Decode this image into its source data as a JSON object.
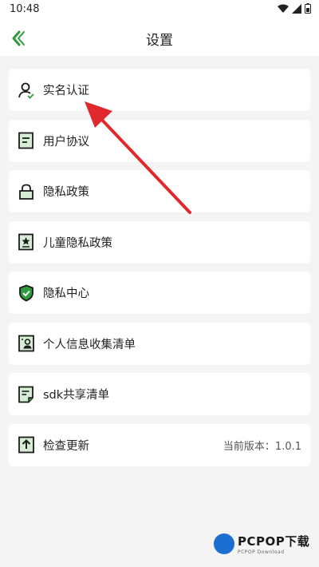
{
  "status": {
    "time": "10:48"
  },
  "header": {
    "title": "设置"
  },
  "items": [
    {
      "label": "实名认证",
      "icon": "user-verify-icon"
    },
    {
      "label": "用户协议",
      "icon": "document-icon"
    },
    {
      "label": "隐私政策",
      "icon": "lock-icon"
    },
    {
      "label": "儿童隐私政策",
      "icon": "star-document-icon"
    },
    {
      "label": "隐私中心",
      "icon": "shield-check-icon"
    },
    {
      "label": "个人信息收集清单",
      "icon": "id-card-icon"
    },
    {
      "label": "sdk共享清单",
      "icon": "list-document-icon"
    },
    {
      "label": "检查更新",
      "icon": "upload-icon",
      "right": "当前版本：1.0.1"
    }
  ],
  "watermark": {
    "main": "PCPOP下载",
    "sub": "PCPOP Download"
  },
  "colors": {
    "accent": "#2e9a3c",
    "arrow": "#e0282d"
  }
}
